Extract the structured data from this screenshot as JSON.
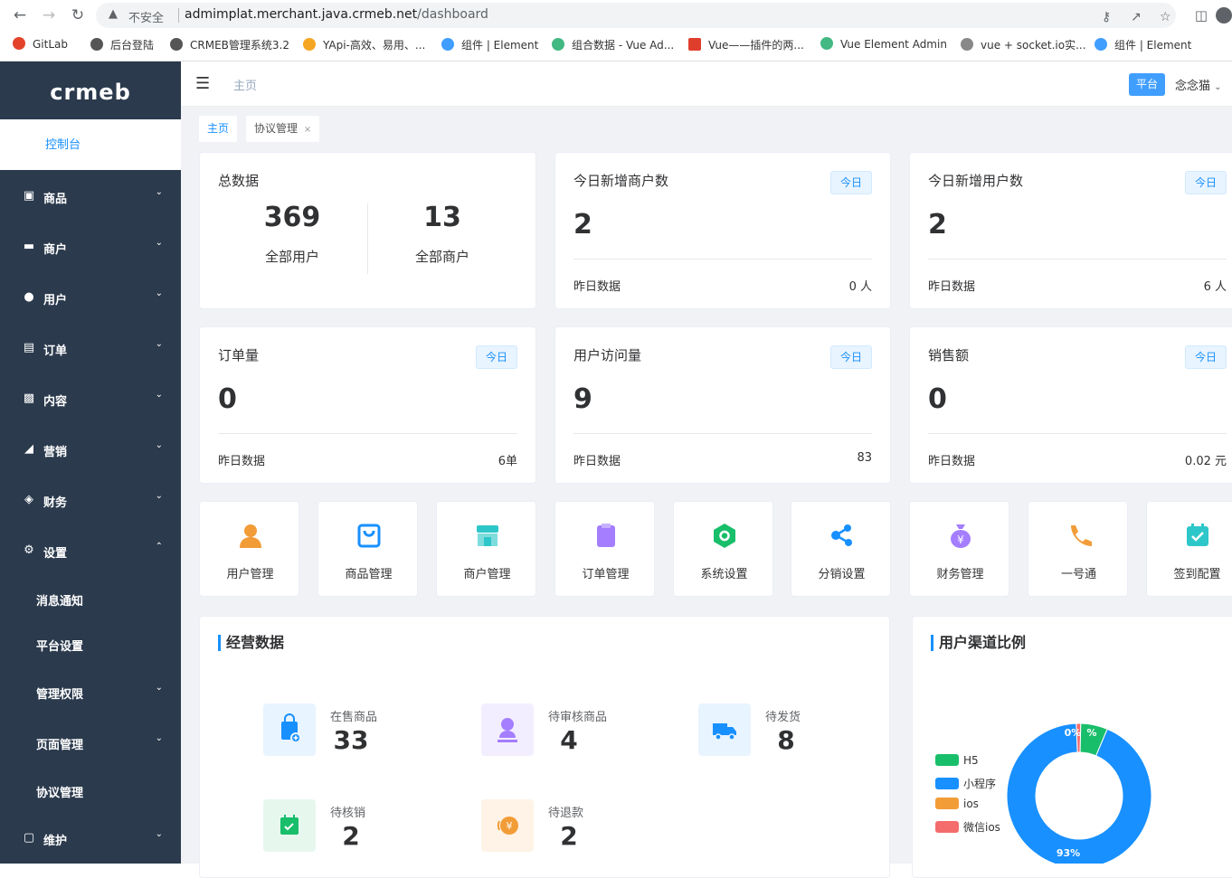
{
  "browser": {
    "insecure_label": "不安全",
    "url_host": "admimplat.merchant.java.crmeb.net",
    "url_path": "/dashboard",
    "bookmarks": [
      {
        "label": "GitLab",
        "color": "#e24329"
      },
      {
        "label": "后台登陆",
        "color": "#555555"
      },
      {
        "label": "CRMEB管理系统3.2",
        "color": "#555555"
      },
      {
        "label": "YApi-高效、易用、...",
        "color": "#f5a623"
      },
      {
        "label": "组件 | Element",
        "color": "#409eff"
      },
      {
        "label": "组合数据 - Vue Ad...",
        "color": "#42b883"
      },
      {
        "label": "Vue——插件的两...",
        "color": "#e03e2d"
      },
      {
        "label": "Vue Element Admin",
        "color": "#42b883"
      },
      {
        "label": "vue + socket.io实...",
        "color": "#888888"
      },
      {
        "label": "组件 | Element",
        "color": "#409eff"
      }
    ]
  },
  "sidebar": {
    "logo": "crmeb",
    "console": "控制台",
    "items": [
      {
        "label": "商品",
        "icon": "lock-icon"
      },
      {
        "label": "商户",
        "icon": "store-icon"
      },
      {
        "label": "用户",
        "icon": "user-icon"
      },
      {
        "label": "订单",
        "icon": "clipboard-icon"
      },
      {
        "label": "内容",
        "icon": "book-icon"
      },
      {
        "label": "营销",
        "icon": "chart-icon"
      },
      {
        "label": "财务",
        "icon": "wallet-icon"
      },
      {
        "label": "设置",
        "icon": "gear-icon"
      }
    ],
    "sub_items": [
      {
        "label": "消息通知"
      },
      {
        "label": "平台设置"
      },
      {
        "label": "管理权限"
      },
      {
        "label": "页面管理"
      },
      {
        "label": "协议管理"
      }
    ],
    "maintain": "维护"
  },
  "topbar": {
    "breadcrumb": "主页",
    "platform_badge": "平台",
    "username": "念念猫"
  },
  "tags": {
    "home": "主页",
    "agreement": "协议管理",
    "close": "×"
  },
  "stats": {
    "total": {
      "title": "总数据",
      "users": "369",
      "users_label": "全部用户",
      "merchants": "13",
      "merchants_label": "全部商户"
    },
    "today_badge": "今日",
    "yesterday_label": "昨日数据",
    "new_merchants": {
      "title": "今日新增商户数",
      "value": "2",
      "yesterday": "0 人"
    },
    "new_users": {
      "title": "今日新增用户数",
      "value": "2",
      "yesterday": "6 人"
    },
    "orders": {
      "title": "订单量",
      "value": "0",
      "yesterday": "6单"
    },
    "visits": {
      "title": "用户访问量",
      "value": "9",
      "yesterday": "83"
    },
    "sales": {
      "title": "销售额",
      "value": "0",
      "yesterday": "0.02 元"
    }
  },
  "quick_links": [
    {
      "label": "用户管理",
      "color": "#f29c38"
    },
    {
      "label": "商品管理",
      "color": "#1890ff"
    },
    {
      "label": "商户管理",
      "color": "#2ec7c9"
    },
    {
      "label": "订单管理",
      "color": "#a47eff"
    },
    {
      "label": "系统设置",
      "color": "#19be6b"
    },
    {
      "label": "分销设置",
      "color": "#1890ff"
    },
    {
      "label": "财务管理",
      "color": "#a47eff"
    },
    {
      "label": "一号通",
      "color": "#f29c38"
    },
    {
      "label": "签到配置",
      "color": "#2ec7c9"
    }
  ],
  "operations": {
    "title": "经营数据",
    "items": [
      {
        "label": "在售商品",
        "value": "33",
        "color": "#1890ff",
        "bg": "#e8f4ff"
      },
      {
        "label": "待审核商品",
        "value": "4",
        "color": "#a47eff",
        "bg": "#f3eeff"
      },
      {
        "label": "待发货",
        "value": "8",
        "color": "#1890ff",
        "bg": "#e8f4ff"
      },
      {
        "label": "待核销",
        "value": "2",
        "color": "#19be6b",
        "bg": "#e6f7ee"
      },
      {
        "label": "待退款",
        "value": "2",
        "color": "#f29c38",
        "bg": "#fef3e6"
      }
    ]
  },
  "chart_data": {
    "type": "pie",
    "title": "用户渠道比例",
    "categories": [
      "H5",
      "小程序",
      "ios",
      "微信ios"
    ],
    "values": [
      6,
      93,
      0,
      1
    ],
    "colors": [
      "#19be6b",
      "#1890ff",
      "#f29c38",
      "#f56c6c"
    ],
    "labels": [
      "%",
      "93%",
      "",
      "0%"
    ],
    "donut": true
  }
}
